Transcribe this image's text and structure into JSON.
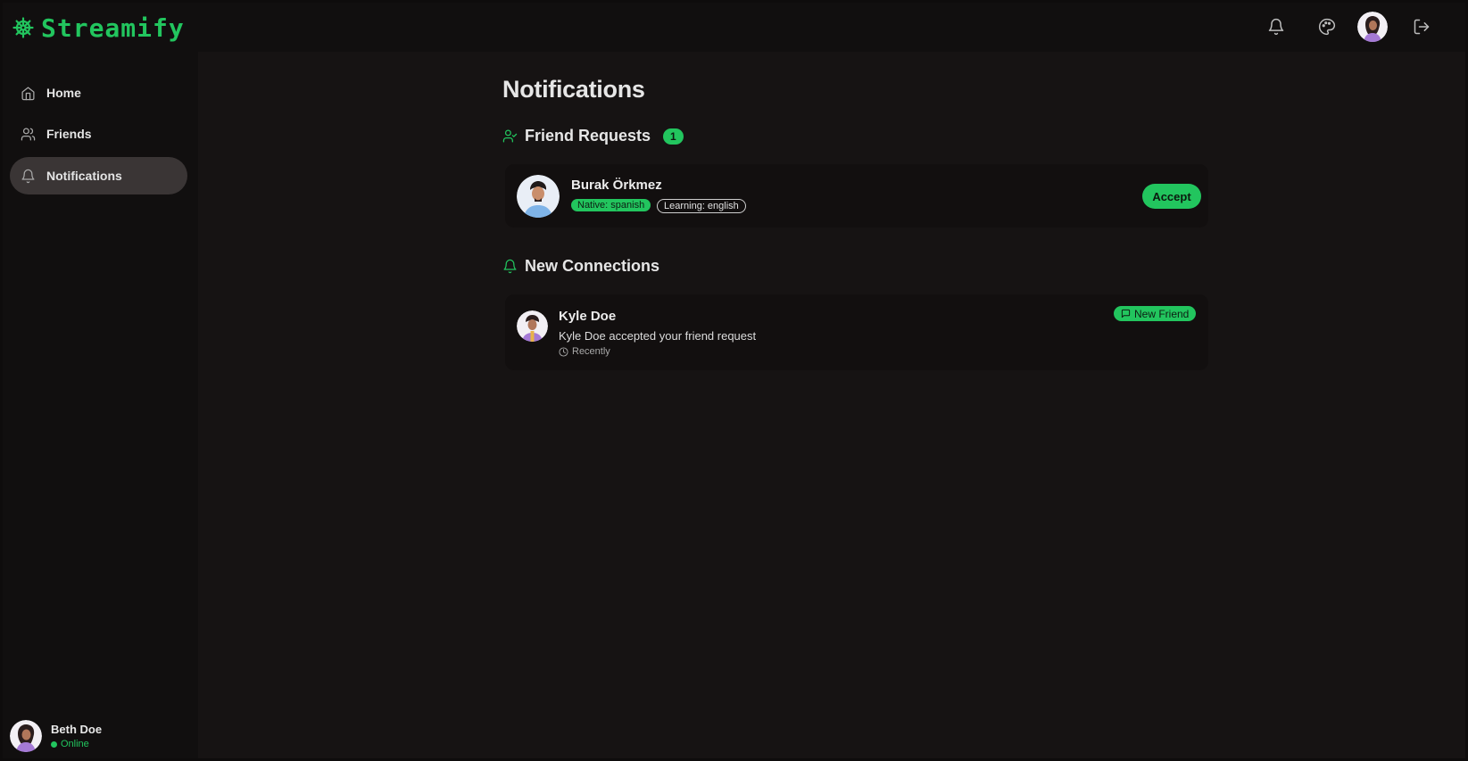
{
  "brand": {
    "name": "Streamify",
    "icon": "ship-wheel-icon"
  },
  "topbar": {
    "icons": [
      "bell-icon",
      "palette-icon",
      "logout-icon"
    ]
  },
  "sidebar": {
    "items": [
      {
        "label": "Home",
        "icon": "home-icon",
        "active": false
      },
      {
        "label": "Friends",
        "icon": "users-icon",
        "active": false
      },
      {
        "label": "Notifications",
        "icon": "bell-icon",
        "active": true
      }
    ],
    "user": {
      "name": "Beth Doe",
      "status": "Online"
    }
  },
  "main": {
    "title": "Notifications",
    "friend_requests": {
      "heading": "Friend Requests",
      "count": "1",
      "items": [
        {
          "name": "Burak Örkmez",
          "native": "Native: spanish",
          "learning": "Learning: english",
          "action": "Accept"
        }
      ]
    },
    "new_connections": {
      "heading": "New Connections",
      "items": [
        {
          "name": "Kyle Doe",
          "message": "Kyle Doe accepted your friend request",
          "time": "Recently",
          "badge": "New Friend"
        }
      ]
    }
  },
  "colors": {
    "accent": "#22c55e",
    "background": "#161313",
    "sidebar": "#110f0f"
  }
}
